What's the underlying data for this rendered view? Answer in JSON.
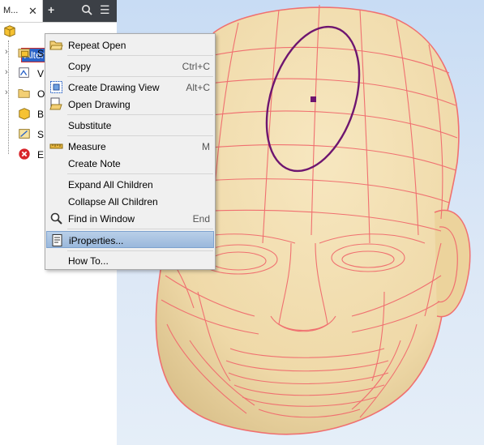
{
  "panel": {
    "tab_label": "M...",
    "root_label": "Alternator.ipt",
    "tree": [
      {
        "label": "S"
      },
      {
        "label": "V"
      },
      {
        "label": "O"
      },
      {
        "label": "B"
      },
      {
        "label": "S"
      },
      {
        "label": "E"
      }
    ]
  },
  "context_menu": {
    "items": [
      {
        "label": "Repeat Open",
        "shortcut": "",
        "icon": "folder-open-icon"
      },
      {
        "label": "Copy",
        "shortcut": "Ctrl+C",
        "icon": ""
      },
      {
        "label": "Create Drawing View",
        "shortcut": "Alt+C",
        "icon": "drawing-view-icon"
      },
      {
        "label": "Open Drawing",
        "shortcut": "",
        "icon": "open-drawing-icon"
      },
      {
        "label": "Substitute",
        "shortcut": "",
        "icon": ""
      },
      {
        "label": "Measure",
        "shortcut": "M",
        "icon": "ruler-icon"
      },
      {
        "label": "Create Note",
        "shortcut": "",
        "icon": ""
      },
      {
        "label": "Expand All Children",
        "shortcut": "",
        "icon": ""
      },
      {
        "label": "Collapse All Children",
        "shortcut": "",
        "icon": ""
      },
      {
        "label": "Find in Window",
        "shortcut": "End",
        "icon": "magnifier-icon"
      },
      {
        "label": "iProperties...",
        "shortcut": "",
        "icon": "iproperties-icon",
        "highlighted": true
      },
      {
        "label": "How To...",
        "shortcut": "",
        "icon": ""
      }
    ]
  },
  "colors": {
    "selection_blue": "#2a63c8",
    "toolbar_dark": "#3c4046",
    "model_skin": "#f2dfb2",
    "edge_lines": "#f07070",
    "sketch_ellipse": "#6e1570"
  }
}
